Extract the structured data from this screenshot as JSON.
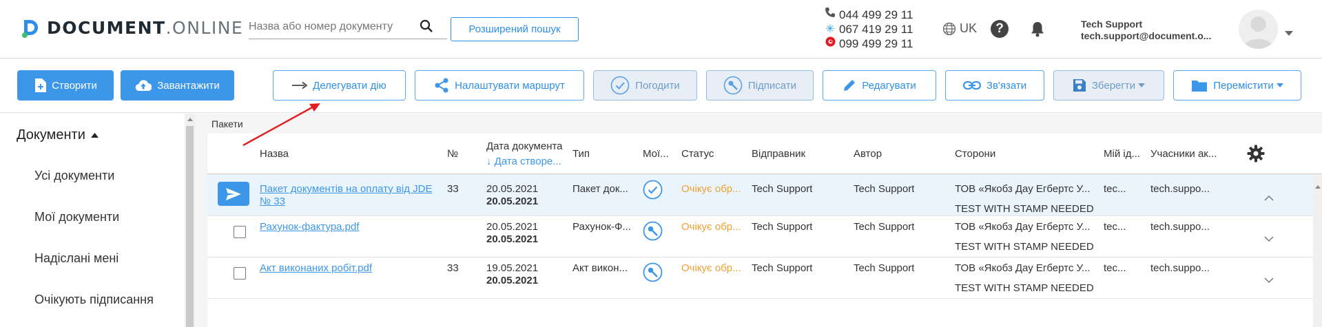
{
  "header": {
    "logo_main": "DOCUMENT",
    "logo_dot": ".",
    "logo_suffix": "ONLINE",
    "search_placeholder": "Назва або номер документу",
    "advanced_search_label": "Розширений пошук",
    "phones": [
      "044 499 29 11",
      "067 419 29 11",
      "099 499 29 11"
    ],
    "language": "UK",
    "user_name": "Tech Support",
    "user_email": "tech.support@document.o..."
  },
  "toolbar": {
    "create_label": "Створити",
    "upload_label": "Завантажити",
    "delegate_label": "Делегувати дію",
    "route_label": "Налаштувати маршрут",
    "approve_label": "Погодити",
    "sign_label": "Підписати",
    "edit_label": "Редагувати",
    "link_label": "Зв'язати",
    "save_label": "Зберегти",
    "move_label": "Перемістити"
  },
  "sidebar": {
    "title": "Документи",
    "items": [
      {
        "label": "Усі документи"
      },
      {
        "label": "Мої документи"
      },
      {
        "label": "Надіслані мені"
      },
      {
        "label": "Очікують підписання"
      }
    ]
  },
  "breadcrumb": "Пакети",
  "table": {
    "columns": {
      "name": "Назва",
      "number": "№",
      "doc_date": "Дата документа",
      "created_date": "↓ Дата створе...",
      "type": "Тип",
      "my": "Мої...",
      "status": "Статус",
      "sender": "Відправник",
      "author": "Автор",
      "parties": "Сторони",
      "my_id": "Мій ід...",
      "participants": "Учасники ак..."
    },
    "rows": [
      {
        "name_line1": "Пакет документів на оплату від JDE",
        "name_line2": "№ 33",
        "number": "33",
        "doc_date": "20.05.2021",
        "created_date": "20.05.2021",
        "type": "Пакет док...",
        "action_icon": "check-circle-icon",
        "status": "Очікує обр...",
        "sender": "Tech Support",
        "author": "Tech Support",
        "party1": "ТОВ «Якобз Дау Егбертс У...",
        "party2": "TEST WITH STAMP NEEDED",
        "my_id": "tec...",
        "participants": "tech.suppo...",
        "expanded": true
      },
      {
        "name_line1": "Рахунок-фактура.pdf",
        "name_line2": "",
        "number": "",
        "doc_date": "20.05.2021",
        "created_date": "20.05.2021",
        "type": "Рахунок-Ф...",
        "action_icon": "sign-icon",
        "status": "Очікує обр...",
        "sender": "Tech Support",
        "author": "Tech Support",
        "party1": "ТОВ «Якобз Дау Егбертс У...",
        "party2": "TEST WITH STAMP NEEDED",
        "my_id": "tec...",
        "participants": "tech.suppo...",
        "expanded": false
      },
      {
        "name_line1": "Акт виконаних робіт.pdf",
        "name_line2": "",
        "number": "33",
        "doc_date": "19.05.2021",
        "created_date": "20.05.2021",
        "type": "Акт викон...",
        "action_icon": "sign-icon",
        "status": "Очікує обр...",
        "sender": "Tech Support",
        "author": "Tech Support",
        "party1": "ТОВ «Якобз Дау Егбертс У...",
        "party2": "TEST WITH STAMP NEEDED",
        "my_id": "tec...",
        "participants": "tech.suppo...",
        "expanded": false
      }
    ]
  },
  "colors": {
    "accent": "#3d97e9",
    "status_pending": "#f0a030",
    "annotation_arrow": "#e02020"
  }
}
